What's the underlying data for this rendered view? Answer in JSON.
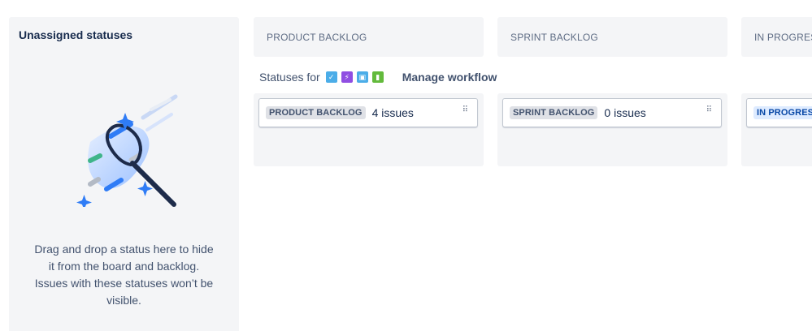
{
  "unassigned": {
    "title": "Unassigned statuses",
    "help_text": "Drag and drop a status here to hide it from the board and backlog. Issues with these statuses won’t be visible."
  },
  "columns": [
    {
      "header": "PRODUCT BACKLOG",
      "status_label": "PRODUCT BACKLOG",
      "issue_count": "4 issues",
      "status_color": "#dfe1e6"
    },
    {
      "header": "SPRINT BACKLOG",
      "status_label": "SPRINT BACKLOG",
      "issue_count": "0 issues",
      "status_color": "#dfe1e6"
    },
    {
      "header": "IN PROGRESS",
      "status_label": "IN PROGRESS",
      "issue_count": "",
      "status_color": "#deebff"
    }
  ],
  "statuses_for": {
    "label": "Statuses for",
    "issue_types": [
      {
        "icon": "task-icon",
        "color": "#4bade8"
      },
      {
        "icon": "epic-icon",
        "color": "#904ee2"
      },
      {
        "icon": "subtask-icon",
        "color": "#4bade8"
      },
      {
        "icon": "story-icon",
        "color": "#63ba3c"
      }
    ],
    "manage_label": "Manage workflow"
  }
}
